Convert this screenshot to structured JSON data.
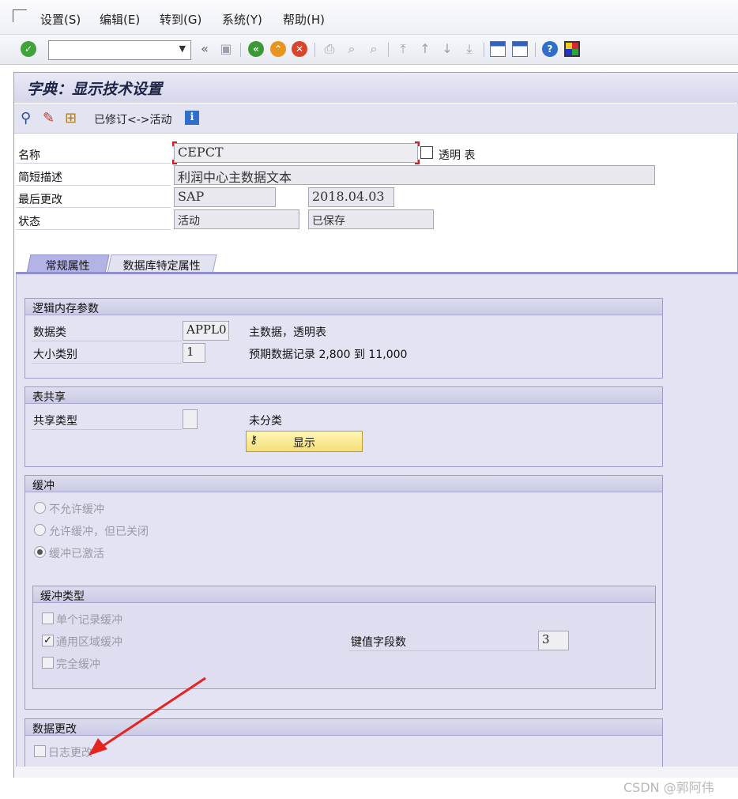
{
  "menu": {
    "items": [
      "设置(S)",
      "编辑(E)",
      "转到(G)",
      "系统(Y)",
      "帮助(H)"
    ]
  },
  "toolbar": {
    "command_field_value": "",
    "icons": [
      "confirm-icon",
      "dropdown-icon",
      "history-back-icon",
      "save-icon",
      "back-icon",
      "exit-icon",
      "cancel-icon",
      "print-icon",
      "find-icon",
      "find-next-icon",
      "first-page-icon",
      "previous-page-icon",
      "next-page-icon",
      "last-page-icon",
      "new-session-icon",
      "shortcut-icon",
      "help-icon",
      "customize-layout-icon"
    ]
  },
  "title": "字典：显示技术设置",
  "app_toolbar": {
    "icons": [
      "glasses-icon",
      "magic-wand-icon",
      "object-list-icon",
      "info-icon"
    ],
    "revised_active_label": "已修订<->活动"
  },
  "header": {
    "name_label": "名称",
    "name_value": "CEPCT",
    "table_type": "透明 表",
    "desc_label": "简短描述",
    "desc_value": "利润中心主数据文本",
    "last_changed_label": "最后更改",
    "last_changed_user": "SAP",
    "last_changed_date": "2018.04.03",
    "status_label": "状态",
    "status_value": "活动",
    "save_status": "已保存"
  },
  "tabs": [
    {
      "label": "常规属性",
      "active": true
    },
    {
      "label": "数据库特定属性",
      "active": false
    }
  ],
  "logical_storage": {
    "title": "逻辑内存参数",
    "data_class_label": "数据类",
    "data_class_value": "APPL0",
    "data_class_desc": "主数据，透明表",
    "size_category_label": "大小类别",
    "size_category_value": "1",
    "size_category_desc": "预期数据记录 2,800 到 11,000"
  },
  "table_sharing": {
    "title": "表共享",
    "sharing_type_label": "共享类型",
    "sharing_type_value": "",
    "sharing_type_desc": "未分类",
    "show_button": "显示"
  },
  "buffering": {
    "title": "缓冲",
    "options": [
      {
        "label": "不允许缓冲",
        "selected": false
      },
      {
        "label": "允许缓冲，但已关闭",
        "selected": false
      },
      {
        "label": "缓冲已激活",
        "selected": true
      }
    ],
    "type_title": "缓冲类型",
    "types": [
      {
        "label": "单个记录缓冲",
        "checked": false
      },
      {
        "label": "通用区域缓冲",
        "checked": true
      },
      {
        "label": "完全缓冲",
        "checked": false
      }
    ],
    "key_fields_label": "键值字段数",
    "key_fields_value": "3"
  },
  "data_changes": {
    "title": "数据更改",
    "log_changes_label": "日志更改",
    "log_changes_checked": false
  },
  "colors": {
    "accent": "#8f8fcf",
    "panel": "#e3e3f3",
    "annotation_arrow": "#e8231f"
  },
  "watermark": "CSDN @郭阿伟"
}
